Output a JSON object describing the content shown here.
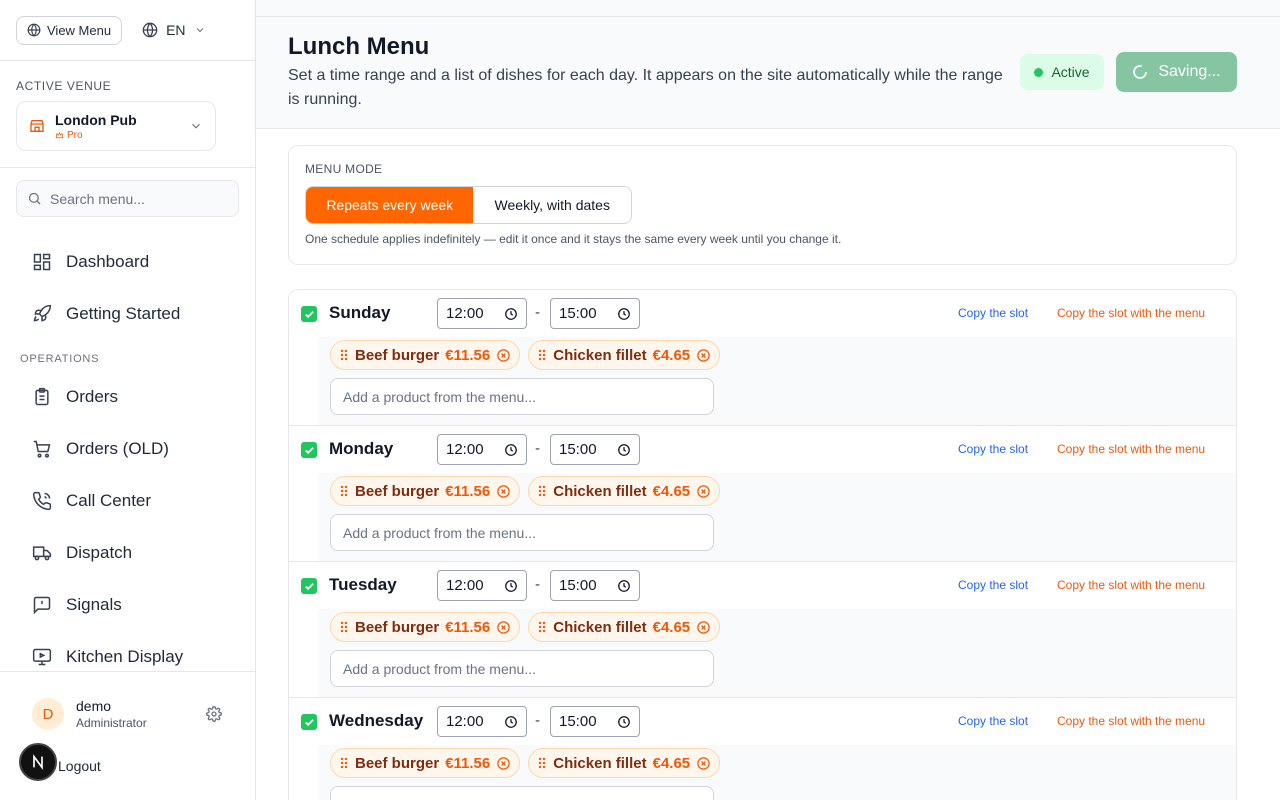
{
  "topbar": {
    "view_menu_label": "View Menu",
    "language": "EN"
  },
  "venue": {
    "section_title": "ACTIVE VENUE",
    "name": "London Pub",
    "plan": "Pro"
  },
  "search": {
    "placeholder": "Search menu..."
  },
  "nav": {
    "items_top": [
      {
        "label": "Dashboard",
        "icon": "dashboard-icon"
      },
      {
        "label": "Getting Started",
        "icon": "rocket-icon"
      }
    ],
    "section_label": "OPERATIONS",
    "items_ops": [
      {
        "label": "Orders",
        "icon": "clipboard-icon"
      },
      {
        "label": "Orders (OLD)",
        "icon": "cart-icon"
      },
      {
        "label": "Call Center",
        "icon": "phone-icon"
      },
      {
        "label": "Dispatch",
        "icon": "truck-icon"
      },
      {
        "label": "Signals",
        "icon": "alert-message-icon"
      },
      {
        "label": "Kitchen Display",
        "icon": "monitor-icon"
      }
    ]
  },
  "user": {
    "initial": "D",
    "name": "demo",
    "role": "Administrator",
    "logout_label": "Logout"
  },
  "header": {
    "title": "Lunch Menu",
    "description": "Set a time range and a list of dishes for each day. It appears on the site automatically while the range is running.",
    "status_label": "Active",
    "save_label": "Saving..."
  },
  "menu_mode": {
    "label": "MENU MODE",
    "options": [
      "Repeats every week",
      "Weekly, with dates"
    ],
    "selected": "Repeats every week",
    "note": "One schedule applies indefinitely — edit it once and it stays the same every week until you change it."
  },
  "copy_labels": {
    "slot": "Copy the slot",
    "slot_with_menu": "Copy the slot with the menu"
  },
  "add_product_placeholder": "Add a product from the menu...",
  "days": [
    {
      "name": "Sunday",
      "enabled": true,
      "start": "12:00",
      "end": "15:00",
      "items": [
        {
          "name": "Beef burger",
          "price": "€11.56"
        },
        {
          "name": "Chicken fillet",
          "price": "€4.65"
        }
      ]
    },
    {
      "name": "Monday",
      "enabled": true,
      "start": "12:00",
      "end": "15:00",
      "items": [
        {
          "name": "Beef burger",
          "price": "€11.56"
        },
        {
          "name": "Chicken fillet",
          "price": "€4.65"
        }
      ]
    },
    {
      "name": "Tuesday",
      "enabled": true,
      "start": "12:00",
      "end": "15:00",
      "items": [
        {
          "name": "Beef burger",
          "price": "€11.56"
        },
        {
          "name": "Chicken fillet",
          "price": "€4.65"
        }
      ]
    },
    {
      "name": "Wednesday",
      "enabled": true,
      "start": "12:00",
      "end": "15:00",
      "items": [
        {
          "name": "Beef burger",
          "price": "€11.56"
        },
        {
          "name": "Chicken fillet",
          "price": "€4.65"
        }
      ]
    }
  ],
  "colors": {
    "accent": "#ff6600",
    "success": "#22c55e",
    "link": "#2563eb"
  }
}
